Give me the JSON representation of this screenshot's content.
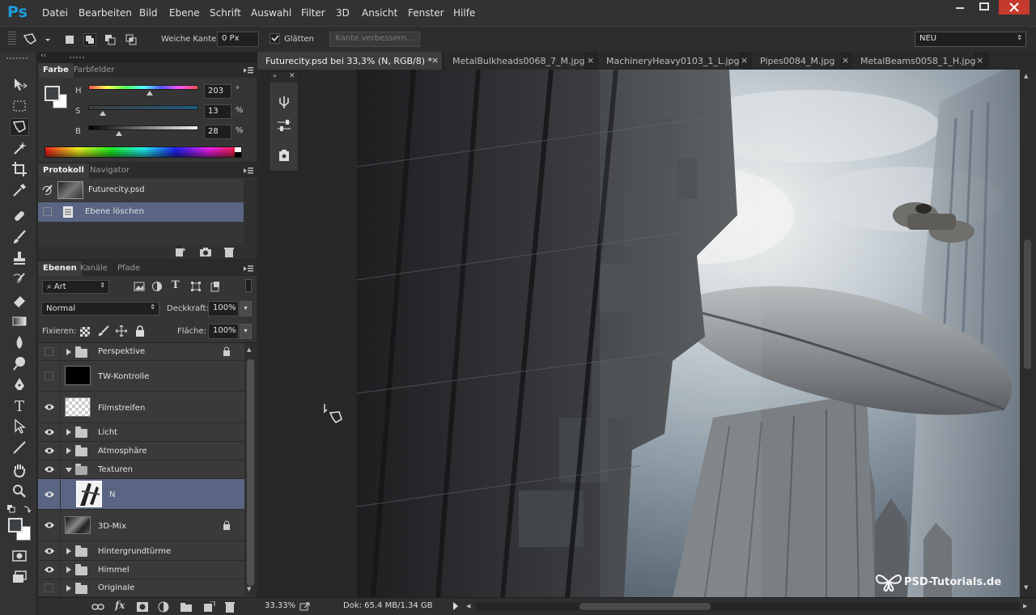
{
  "app": {
    "logo": "Ps"
  },
  "menu": [
    "Datei",
    "Bearbeiten",
    "Bild",
    "Ebene",
    "Schrift",
    "Auswahl",
    "Filter",
    "3D",
    "Ansicht",
    "Fenster",
    "Hilfe"
  ],
  "options": {
    "feather_label": "Weiche Kante:",
    "feather_value": "0 Px",
    "antialias_label": "Glätten",
    "refine_edge": "Kante verbessern...",
    "workspace": "NEU"
  },
  "color_panel": {
    "tabs": [
      "Farbe",
      "Farbfelder"
    ],
    "h_label": "H",
    "h_value": "203",
    "h_unit": "°",
    "s_label": "S",
    "s_value": "13",
    "s_unit": "%",
    "b_label": "B",
    "b_value": "28",
    "b_unit": "%",
    "slider_levels": {
      "h": 0.56,
      "s": 0.13,
      "b": 0.28
    }
  },
  "history_panel": {
    "tabs": [
      "Protokoll",
      "Navigator"
    ],
    "items": [
      {
        "label": "Futurecity.psd",
        "selected": false
      },
      {
        "label": "Ebene löschen",
        "selected": true
      }
    ]
  },
  "layers_panel": {
    "tabs": [
      "Ebenen",
      "Kanäle",
      "Pfade"
    ],
    "filter_kind": "Art",
    "blend_mode": "Normal",
    "opacity_label": "Deckkraft:",
    "opacity_value": "100%",
    "lock_label": "Fixieren:",
    "fill_label": "Fläche:",
    "fill_value": "100%",
    "layers": [
      {
        "name": "Perspektive",
        "type": "group",
        "visible": false,
        "locked": true,
        "expanded": false
      },
      {
        "name": "TW-Kontrolle",
        "type": "layer",
        "visible": false,
        "thumb": "black"
      },
      {
        "name": "Filmstreifen",
        "type": "layer",
        "visible": true,
        "thumb": "transparent"
      },
      {
        "name": "Licht",
        "type": "group",
        "visible": true,
        "expanded": false
      },
      {
        "name": "Atmosphäre",
        "type": "group",
        "visible": true,
        "expanded": false
      },
      {
        "name": "Texturen",
        "type": "group",
        "visible": true,
        "expanded": true
      },
      {
        "name": "N",
        "type": "layer",
        "visible": true,
        "selected": true,
        "thumb": "texture"
      },
      {
        "name": "3D-Mix",
        "type": "layer",
        "visible": true,
        "locked": true,
        "thumb": "city"
      },
      {
        "name": "Hintergrundtürme",
        "type": "group",
        "visible": true,
        "expanded": false
      },
      {
        "name": "Himmel",
        "type": "group",
        "visible": true,
        "expanded": false
      },
      {
        "name": "Originale",
        "type": "group",
        "visible": false,
        "expanded": false
      }
    ]
  },
  "doc_tabs": [
    {
      "label": "Futurecity.psd bei 33,3% (N, RGB/8) *",
      "active": true
    },
    {
      "label": "MetalBulkheads0068_7_M.jpg",
      "active": false
    },
    {
      "label": "MachineryHeavy0103_1_L.jpg",
      "active": false
    },
    {
      "label": "Pipes0084_M.jpg",
      "active": false
    },
    {
      "label": "MetalBeams0058_1_H.jpg",
      "active": false
    }
  ],
  "status": {
    "zoom": "33.33%",
    "doc": "Dok: 65.4 MB/1.34 GB"
  },
  "watermark": "PSD-Tutorials.de",
  "colors": {
    "accent": "#1d9cde",
    "selection": "#5a6584",
    "panel": "#353535"
  }
}
